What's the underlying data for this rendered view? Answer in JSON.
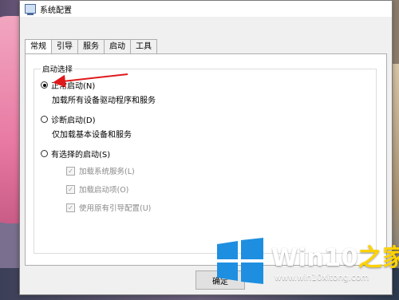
{
  "window": {
    "title": "系统配置"
  },
  "tabs": [
    {
      "label": "常规",
      "active": true
    },
    {
      "label": "引导",
      "active": false
    },
    {
      "label": "服务",
      "active": false
    },
    {
      "label": "启动",
      "active": false
    },
    {
      "label": "工具",
      "active": false
    }
  ],
  "startup_selection": {
    "group_label": "启动选择",
    "options": [
      {
        "label": "正常启动(N)",
        "description": "加载所有设备驱动程序和服务",
        "checked": true
      },
      {
        "label": "诊断启动(D)",
        "description": "仅加载基本设备和服务",
        "checked": false
      },
      {
        "label": "有选择的启动(S)",
        "checked": false
      }
    ],
    "checkboxes": [
      {
        "label": "加载系统服务(L)",
        "checked": true,
        "enabled": false
      },
      {
        "label": "加载启动项(O)",
        "checked": true,
        "enabled": false
      },
      {
        "label": "使用原有引导配置(U)",
        "checked": true,
        "enabled": false
      }
    ]
  },
  "buttons": {
    "ok_label": "确定"
  },
  "watermark": {
    "brand_main": "Win10",
    "brand_accent": "之家",
    "url": "www.win10xitong.com"
  },
  "colors": {
    "arrow": "#e0191b",
    "logo_blue": "#1e8fe0",
    "brand_accent": "#ffd200"
  }
}
